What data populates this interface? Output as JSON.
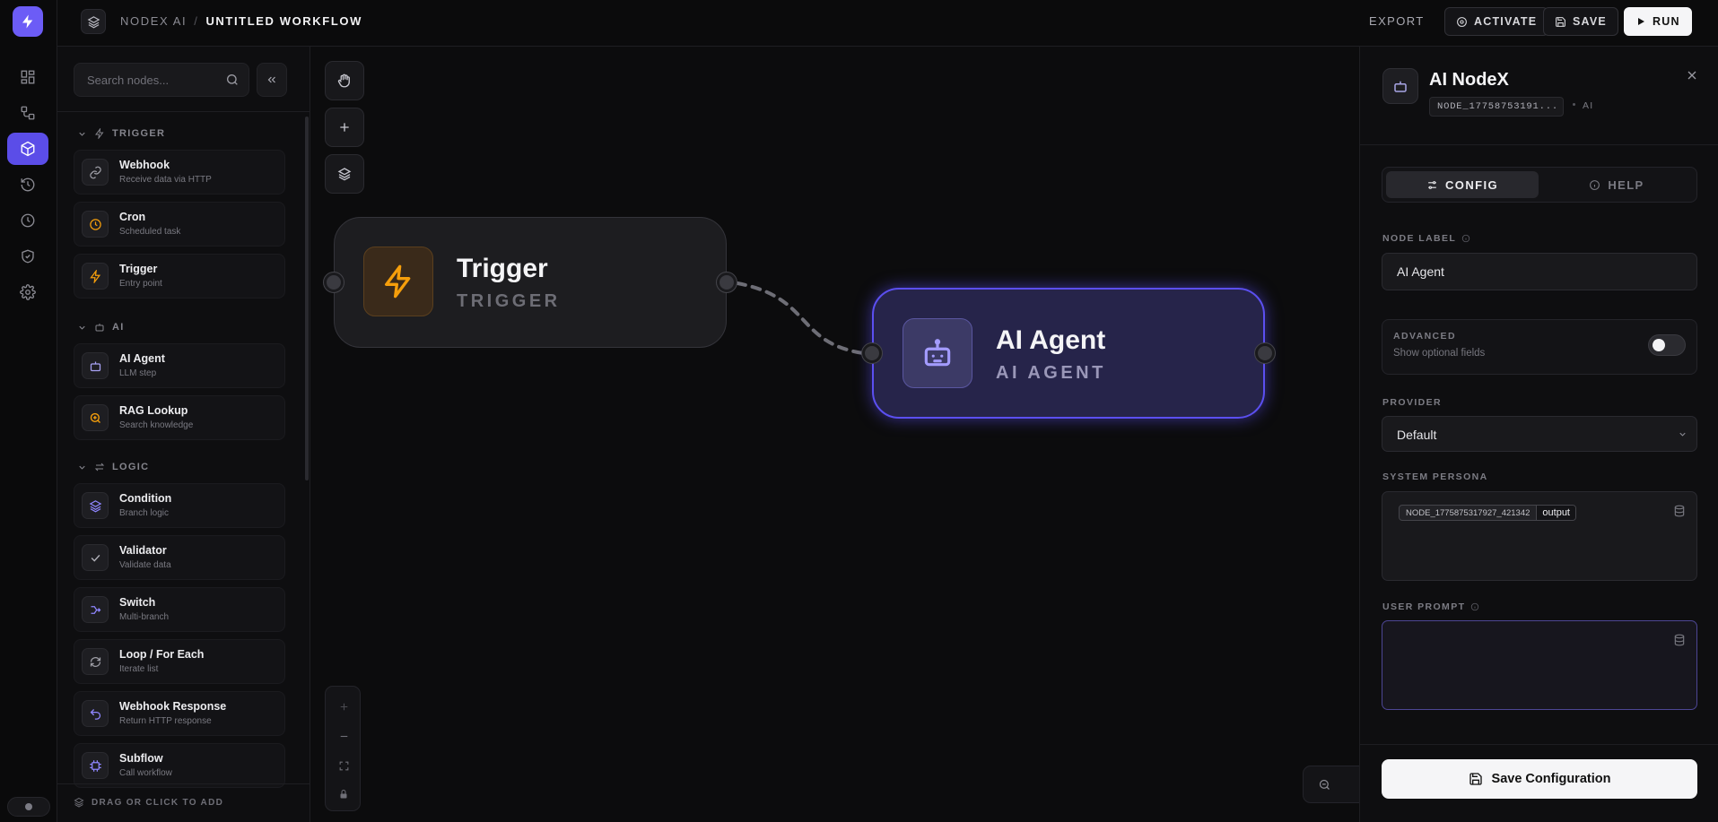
{
  "colors": {
    "accent": "#6c5cf6",
    "trigger": "#f59e0b",
    "agent": "#9b8cff",
    "surface": "#0b0b0c"
  },
  "header": {
    "workspace": "NODEX AI",
    "separator": "/",
    "workflow": "UNTITLED WORKFLOW",
    "export": "EXPORT",
    "activate": "ACTIVATE",
    "save": "SAVE",
    "run": "RUN"
  },
  "rail": {
    "icons": [
      "dashboard-icon",
      "workflows-icon",
      "nodes-icon",
      "history-icon",
      "clock-icon",
      "shield-icon",
      "settings-icon"
    ],
    "active_index": 2
  },
  "library": {
    "search_placeholder": "Search nodes...",
    "sections": [
      {
        "label": "TRIGGER",
        "items": [
          {
            "title": "Webhook",
            "subtitle": "Receive data via HTTP",
            "icon": "link-icon"
          },
          {
            "title": "Cron",
            "subtitle": "Scheduled task",
            "icon": "clock-icon"
          },
          {
            "title": "Trigger",
            "subtitle": "Entry point",
            "icon": "bolt-icon"
          }
        ]
      },
      {
        "label": "AI",
        "items": [
          {
            "title": "AI Agent",
            "subtitle": "LLM step",
            "icon": "robot-icon"
          },
          {
            "title": "RAG Lookup",
            "subtitle": "Search knowledge",
            "icon": "search-zoom-icon"
          }
        ]
      },
      {
        "label": "LOGIC",
        "items": [
          {
            "title": "Condition",
            "subtitle": "Branch logic",
            "icon": "layers-icon"
          },
          {
            "title": "Validator",
            "subtitle": "Validate data",
            "icon": "check-icon"
          },
          {
            "title": "Switch",
            "subtitle": "Multi-branch",
            "icon": "switch-icon"
          },
          {
            "title": "Loop / For Each",
            "subtitle": "Iterate list",
            "icon": "loop-icon"
          },
          {
            "title": "Webhook Response",
            "subtitle": "Return HTTP response",
            "icon": "return-icon"
          },
          {
            "title": "Subflow",
            "subtitle": "Call workflow",
            "icon": "cpu-icon"
          }
        ]
      }
    ],
    "footer": "DRAG OR CLICK TO ADD"
  },
  "canvas": {
    "nodes": [
      {
        "title": "Trigger",
        "type": "TRIGGER"
      },
      {
        "title": "AI Agent",
        "type": "AI AGENT"
      }
    ]
  },
  "panel": {
    "title": "AI NodeX",
    "node_id": "NODE_17758753191...",
    "category": "AI",
    "tabs": {
      "config": "CONFIG",
      "help": "HELP"
    },
    "node_label": {
      "label": "NODE LABEL",
      "value": "AI Agent"
    },
    "advanced": {
      "title": "ADVANCED",
      "subtitle": "Show optional fields",
      "enabled": false
    },
    "provider": {
      "label": "PROVIDER",
      "value": "Default"
    },
    "system_persona": {
      "label": "SYSTEM PERSONA",
      "chip_id": "NODE_1775875317927_421342",
      "chip_field": "output"
    },
    "user_prompt": {
      "label": "USER PROMPT",
      "value": ""
    },
    "save_button": "Save Configuration"
  }
}
